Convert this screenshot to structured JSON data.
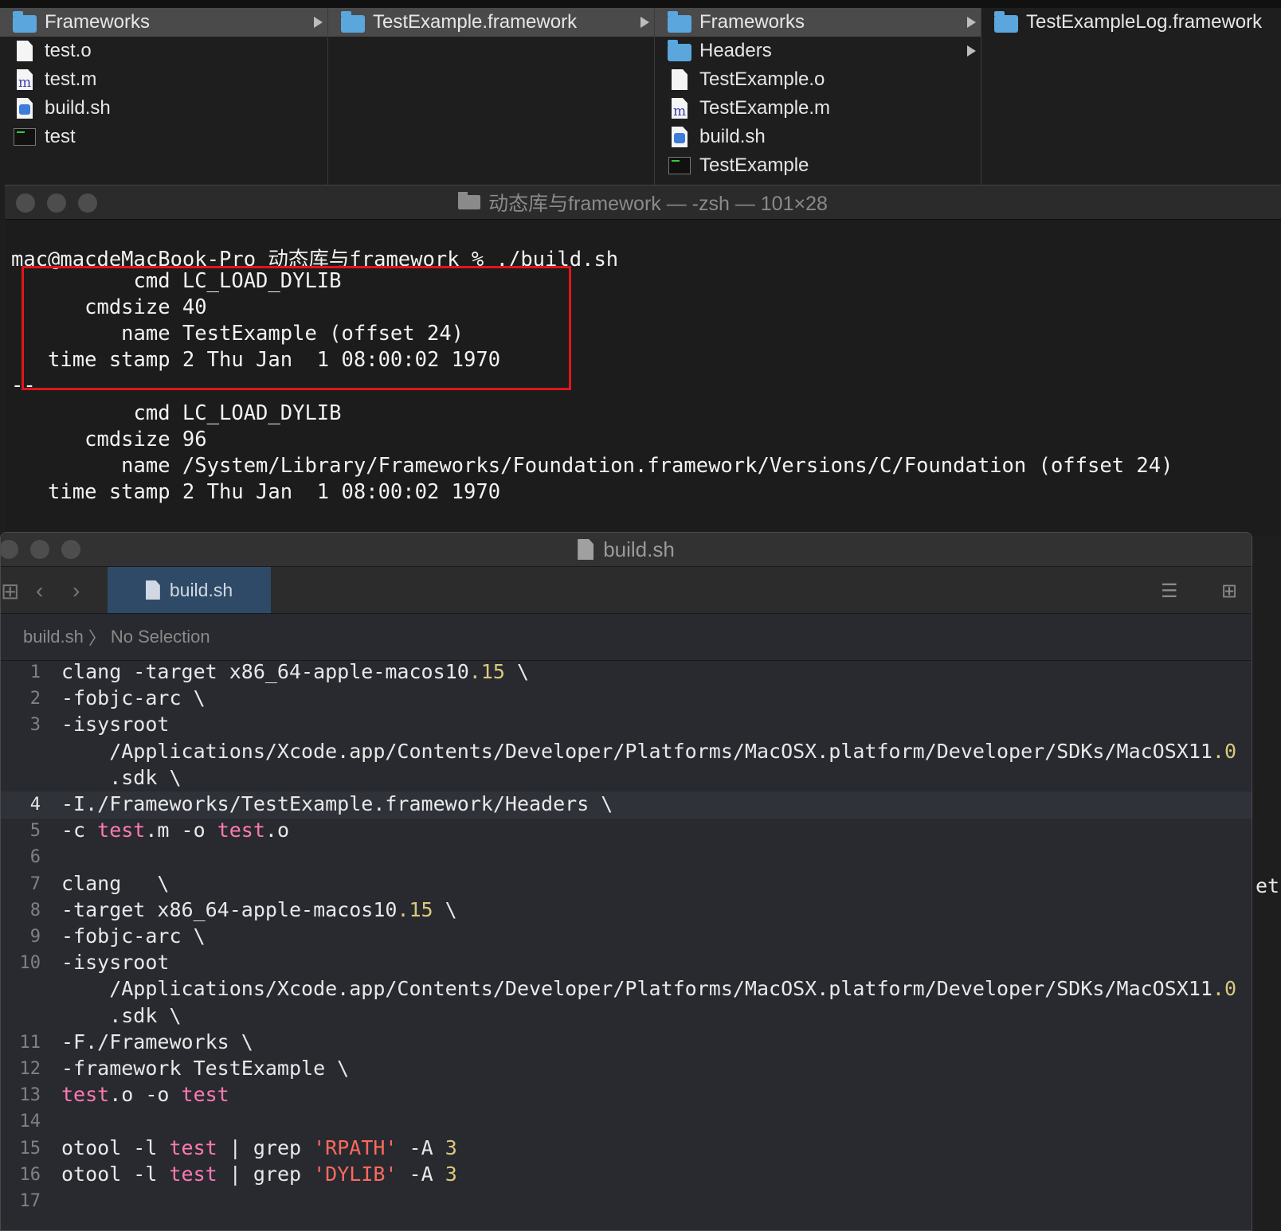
{
  "finder": {
    "columns": [
      {
        "items": [
          {
            "name": "Frameworks",
            "icon": "folder-icon",
            "selected": true,
            "arrow": true
          },
          {
            "name": "test.o",
            "icon": "document-icon"
          },
          {
            "name": "test.m",
            "icon": "objc-file-icon"
          },
          {
            "name": "build.sh",
            "icon": "shell-script-icon"
          },
          {
            "name": "test",
            "icon": "executable-icon"
          }
        ]
      },
      {
        "items": [
          {
            "name": "TestExample.framework",
            "icon": "folder-icon",
            "selected": true,
            "arrow": true
          }
        ]
      },
      {
        "items": [
          {
            "name": "Frameworks",
            "icon": "folder-icon",
            "selected": true,
            "arrow": true
          },
          {
            "name": "Headers",
            "icon": "folder-icon",
            "arrow": true
          },
          {
            "name": "TestExample.o",
            "icon": "document-icon"
          },
          {
            "name": "TestExample.m",
            "icon": "objc-file-icon"
          },
          {
            "name": "build.sh",
            "icon": "shell-script-icon"
          },
          {
            "name": "TestExample",
            "icon": "executable-icon"
          }
        ]
      },
      {
        "items": [
          {
            "name": "TestExampleLog.framework",
            "icon": "folder-icon"
          }
        ]
      }
    ]
  },
  "terminal": {
    "title": "动态库与framework — -zsh — 101×28",
    "lines": [
      "mac@macdeMacBook-Pro 动态库与framework % ./build.sh",
      "          cmd LC_LOAD_DYLIB",
      "      cmdsize 40",
      "         name TestExample (offset 24)",
      "   time stamp 2 Thu Jan  1 08:00:02 1970",
      "--",
      "          cmd LC_LOAD_DYLIB",
      "      cmdsize 96",
      "         name /System/Library/Frameworks/Foundation.framework/Versions/C/Foundation (offset 24)",
      "   time stamp 2 Thu Jan  1 08:00:02 1970"
    ],
    "highlight_color": "#e0161b"
  },
  "editor": {
    "window_title": "build.sh",
    "tab_label": "build.sh",
    "jump_bar": {
      "file": "build.sh",
      "selection": "No Selection"
    },
    "code_lines": [
      {
        "n": "1",
        "text": "clang -target x86_64-apple-macos10.15 \\"
      },
      {
        "n": "2",
        "text": "-fobjc-arc \\"
      },
      {
        "n": "3",
        "text": "-isysroot"
      },
      {
        "n": "",
        "text": "    /Applications/Xcode.app/Contents/Developer/Platforms/MacOSX.platform/Developer/SDKs/MacOSX11.0"
      },
      {
        "n": "",
        "text": "    .sdk \\"
      },
      {
        "n": "4",
        "text": "-I./Frameworks/TestExample.framework/Headers \\"
      },
      {
        "n": "5",
        "text": "-c test.m -o test.o"
      },
      {
        "n": "6",
        "text": ""
      },
      {
        "n": "7",
        "text": "clang   \\"
      },
      {
        "n": "8",
        "text": "-target x86_64-apple-macos10.15 \\"
      },
      {
        "n": "9",
        "text": "-fobjc-arc \\"
      },
      {
        "n": "10",
        "text": "-isysroot"
      },
      {
        "n": "",
        "text": "    /Applications/Xcode.app/Contents/Developer/Platforms/MacOSX.platform/Developer/SDKs/MacOSX11.0"
      },
      {
        "n": "",
        "text": "    .sdk \\"
      },
      {
        "n": "11",
        "text": "-F./Frameworks \\"
      },
      {
        "n": "12",
        "text": "-framework TestExample \\"
      },
      {
        "n": "13",
        "text": "test.o -o test"
      },
      {
        "n": "14",
        "text": ""
      },
      {
        "n": "15",
        "text": "otool -l test | grep 'RPATH' -A 3"
      },
      {
        "n": "16",
        "text": "otool -l test | grep 'DYLIB' -A 3"
      },
      {
        "n": "17",
        "text": ""
      }
    ],
    "current_line": "4",
    "colors": {
      "number": "#d9c97c",
      "string": "#fc6a5d",
      "keyword": "#ff7ab2",
      "text": "#e8e8e8"
    }
  },
  "offscreen_fragment": "et"
}
